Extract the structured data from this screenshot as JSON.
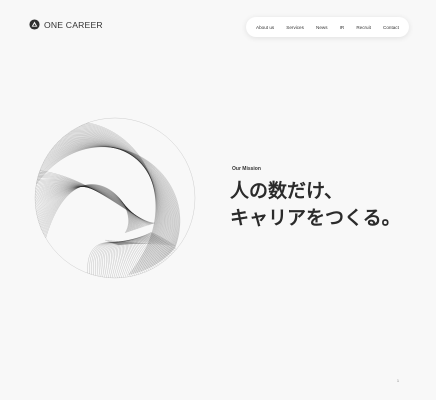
{
  "brand": {
    "name": "ONE CAREER"
  },
  "nav": {
    "items": [
      "About us",
      "Services",
      "News",
      "IR",
      "Recruit",
      "Contact"
    ]
  },
  "hero": {
    "mission_label": "Our Mission",
    "headline_line1": "人の数だけ、",
    "headline_line2": "キャリアをつくる。"
  },
  "page_indicator": "1",
  "colors": {
    "background": "#f8f8f8",
    "text": "#2b2b2b",
    "nav_background": "#ffffff"
  }
}
